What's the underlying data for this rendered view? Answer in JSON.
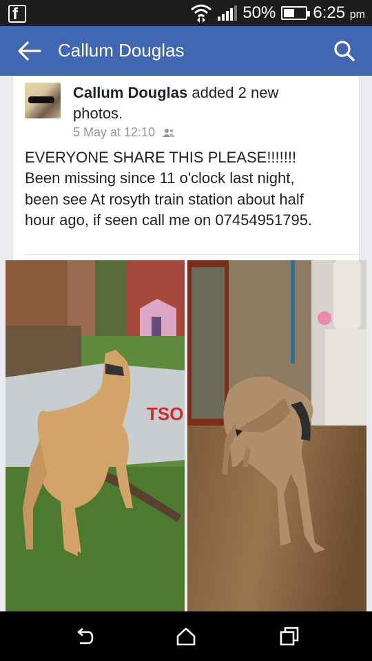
{
  "status_bar": {
    "battery_percent": "50%",
    "battery_level": 0.5,
    "time": "6:25",
    "time_suffix": "pm",
    "icons": [
      "facebook-notification-icon",
      "wifi-icon",
      "signal-icon",
      "battery-icon"
    ]
  },
  "app_bar": {
    "title": "Callum Douglas",
    "icons": [
      "back-arrow-icon",
      "search-icon"
    ]
  },
  "post": {
    "author": "Callum Douglas",
    "action": " added 2 new photos.",
    "timestamp": "5 May at 12:10",
    "privacy_icon": "friends-icon",
    "text": "EVERYONE SHARE THIS PLEASE!!!!!!! Been missing since 11 o'clock last night, been see At rosyth train station about half hour ago, if seen call me on 07454951795."
  },
  "nav_bar": {
    "icons": [
      "back-icon",
      "home-icon",
      "recent-apps-icon"
    ]
  },
  "colors": {
    "facebook_blue": "#4267b2",
    "status_bar": "#1d1d1d",
    "nav_bar": "#000000"
  }
}
